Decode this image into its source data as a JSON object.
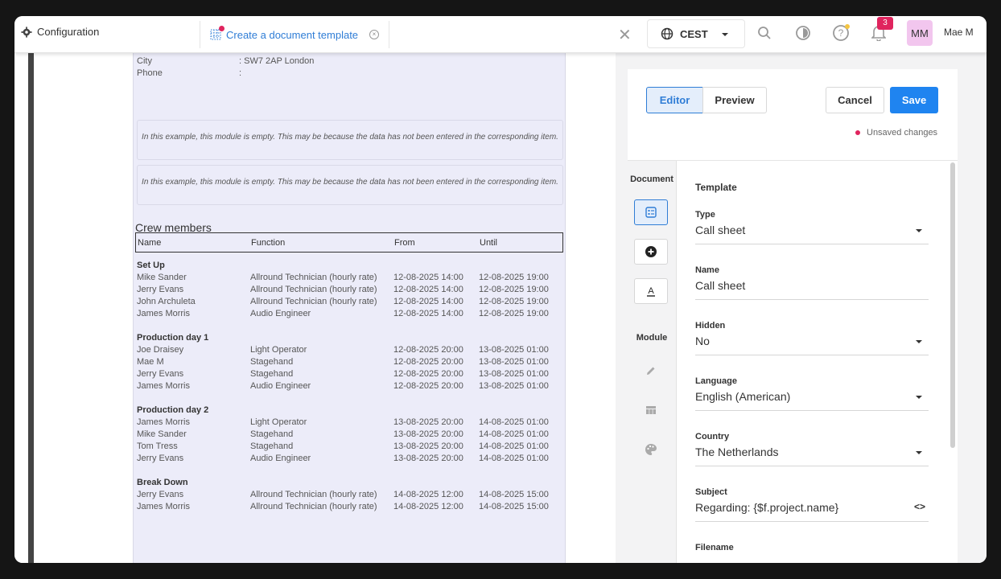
{
  "topbar": {
    "config_label": "Configuration",
    "tab_label": "Create a document template",
    "timezone": "CEST",
    "notification_count": "3",
    "avatar_initials": "MM",
    "username": "Mae M"
  },
  "document": {
    "fields": [
      {
        "label": "City",
        "value": ": SW7 2AP London"
      },
      {
        "label": "Phone",
        "value": ":"
      }
    ],
    "empty_message_1": "In this example, this module is empty. This may be because the data has not been entered in the corresponding item.",
    "empty_message_2": "In this example, this module is empty. This may be because the data has not been entered in the corresponding item.",
    "crew_title": "Crew members",
    "columns": [
      "Name",
      "Function",
      "From",
      "Until"
    ],
    "groups": [
      {
        "title": "Set Up",
        "rows": [
          [
            "Mike Sander",
            "Allround Technician (hourly rate)",
            "12-08-2025 14:00",
            "12-08-2025 19:00"
          ],
          [
            "Jerry Evans",
            "Allround Technician (hourly rate)",
            "12-08-2025 14:00",
            "12-08-2025 19:00"
          ],
          [
            "John Archuleta",
            "Allround Technician (hourly rate)",
            "12-08-2025 14:00",
            "12-08-2025 19:00"
          ],
          [
            "James Morris",
            "Audio Engineer",
            "12-08-2025 14:00",
            "12-08-2025 19:00"
          ]
        ]
      },
      {
        "title": "Production day 1",
        "rows": [
          [
            "Joe Draisey",
            "Light Operator",
            "12-08-2025 20:00",
            "13-08-2025 01:00"
          ],
          [
            "Mae M",
            "Stagehand",
            "12-08-2025 20:00",
            "13-08-2025 01:00"
          ],
          [
            "Jerry Evans",
            "Stagehand",
            "12-08-2025 20:00",
            "13-08-2025 01:00"
          ],
          [
            "James Morris",
            "Audio Engineer",
            "12-08-2025 20:00",
            "13-08-2025 01:00"
          ]
        ]
      },
      {
        "title": "Production day 2",
        "rows": [
          [
            "James Morris",
            "Light Operator",
            "13-08-2025 20:00",
            "14-08-2025 01:00"
          ],
          [
            "Mike Sander",
            "Stagehand",
            "13-08-2025 20:00",
            "14-08-2025 01:00"
          ],
          [
            "Tom Tress",
            "Stagehand",
            "13-08-2025 20:00",
            "14-08-2025 01:00"
          ],
          [
            "Jerry Evans",
            "Audio Engineer",
            "13-08-2025 20:00",
            "14-08-2025 01:00"
          ]
        ]
      },
      {
        "title": "Break Down",
        "rows": [
          [
            "Jerry Evans",
            "Allround Technician (hourly rate)",
            "14-08-2025 12:00",
            "14-08-2025 15:00"
          ],
          [
            "James Morris",
            "Allround Technician (hourly rate)",
            "14-08-2025 12:00",
            "14-08-2025 15:00"
          ]
        ]
      }
    ]
  },
  "panel": {
    "editor_label": "Editor",
    "preview_label": "Preview",
    "cancel_label": "Cancel",
    "save_label": "Save",
    "unsaved_label": "Unsaved changes",
    "document_section": "Document",
    "module_section": "Module",
    "form_title": "Template",
    "fields": [
      {
        "label": "Type",
        "value": "Call sheet",
        "kind": "select"
      },
      {
        "label": "Name",
        "value": "Call sheet",
        "kind": "text"
      },
      {
        "label": "Hidden",
        "value": "No",
        "kind": "select"
      },
      {
        "label": "Language",
        "value": "English (American)",
        "kind": "select"
      },
      {
        "label": "Country",
        "value": "The Netherlands",
        "kind": "select"
      },
      {
        "label": "Subject",
        "value": "Regarding: {$f.project.name}",
        "kind": "code"
      },
      {
        "label": "Filename",
        "value": "",
        "kind": "text"
      }
    ],
    "code_symbol": "<>"
  },
  "colors": {
    "accent": "#1f84f0",
    "alert": "#e0245e",
    "doc_background": "#ececf9"
  }
}
